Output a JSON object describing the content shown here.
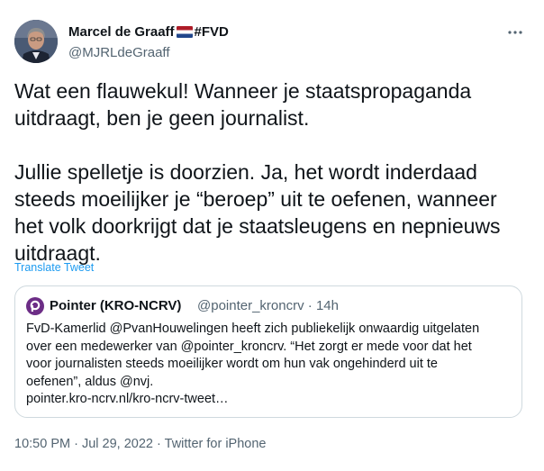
{
  "author": {
    "display_name": "Marcel de Graaff",
    "tag": "#FVD",
    "handle": "@MJRLdeGraaff",
    "flag": "netherlands-flag"
  },
  "tweet": {
    "text": "Wat een flauwekul! Wanneer je staatspropaganda uitdraagt, ben je geen journalist.\n\nJullie spelletje is doorzien. Ja, het wordt inderdaad steeds moeilijker je “beroep” uit te oefenen, wanneer het volk doorkrijgt dat je staatsleugens en nepnieuws uitdraagt.",
    "translate_label": "Translate Tweet"
  },
  "quoted": {
    "name": "Pointer (KRO-NCRV)",
    "handle": "@pointer_kroncrv",
    "separator": "·",
    "time": "14h",
    "text": "FvD-Kamerlid @PvanHouwelingen heeft zich publiekelijk onwaardig uitgelaten\nover een medewerker van @pointer_kroncrv. “Het zorgt er mede voor dat het\nvoor journalisten steeds moeilijker wordt om hun vak ongehinderd uit te\noefenen”, aldus @nvj.\npointer.kro-ncrv.nl/kro-ncrv-tweet…"
  },
  "footer": {
    "time": "10:50 PM",
    "date": "Jul 29, 2022",
    "source": "Twitter for iPhone",
    "separator": "·"
  },
  "colors": {
    "link": "#1d9bf0",
    "secondary_text": "#536471",
    "border": "#cfd9de",
    "pointer_logo": "#6c2d86"
  }
}
